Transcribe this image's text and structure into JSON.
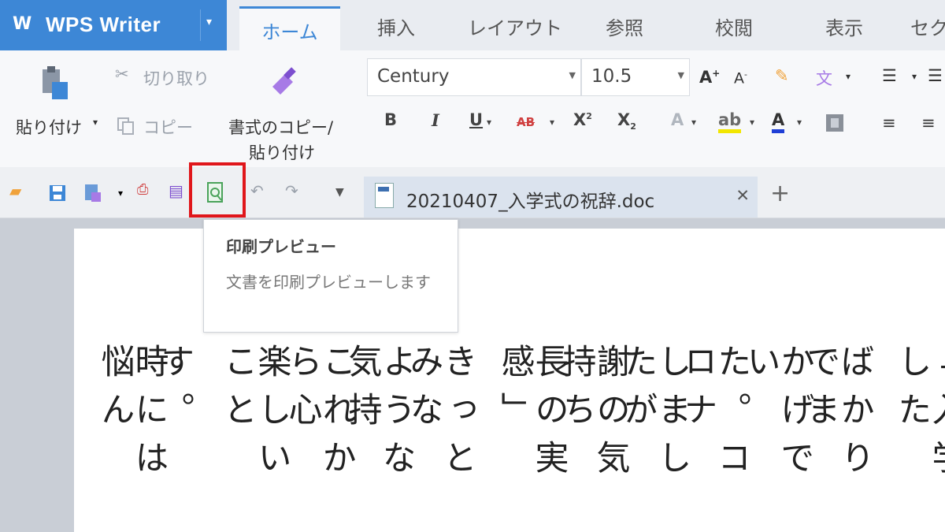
{
  "app": {
    "name": "WPS Writer",
    "logo": "W",
    "menu_arrow": "▾"
  },
  "tabs": [
    {
      "label": "ホーム",
      "active": true
    },
    {
      "label": "挿入"
    },
    {
      "label": "レイアウト"
    },
    {
      "label": "参照"
    },
    {
      "label": "校閲"
    },
    {
      "label": "表示"
    },
    {
      "label": "セク"
    }
  ],
  "ribbon": {
    "paste_label": "貼り付け",
    "cut_label": "切り取り",
    "copy_label": "コピー",
    "format_painter_label_1": "書式のコピー/",
    "format_painter_label_2": "貼り付け",
    "font_name": "Century",
    "font_size": "10.5"
  },
  "document": {
    "filename": "20210407_入学式の祝辞.doc",
    "columns": [
      "「入学した",
      "ばかりでま",
      "かげでい",
      "た。コロナ",
      "しましたが",
      "謝の気持ち",
      "長の実感」",
      "きっとみな",
      "ような気持",
      "これから心",
      "楽しいこと",
      "す。",
      "時には悩ん"
    ]
  },
  "tooltip": {
    "title": "印刷プレビュー",
    "description": "文書を印刷プレビューします"
  },
  "colors": {
    "accent": "#3d87d6",
    "highlight": "#e0161b"
  }
}
